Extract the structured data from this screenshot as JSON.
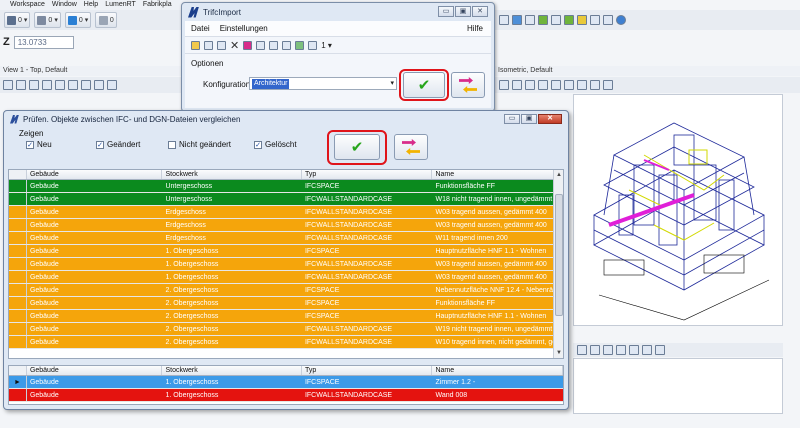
{
  "app": {
    "menu": [
      "Workspace",
      "Window",
      "Help",
      "LumenRT",
      "Fabrikpla"
    ],
    "z_label": "Z",
    "z_value": "13.0733",
    "view1_title": "View 1 - Top, Default",
    "iso_title": "Isometric, Default",
    "toolbar_counts": [
      "0",
      "0",
      "0",
      "0"
    ]
  },
  "trif": {
    "title": "TrifcImport",
    "menu": {
      "datei": "Datei",
      "einstellungen": "Einstellungen",
      "hilfe": "Hilfe"
    },
    "toolbar_page": "1",
    "optionen_label": "Optionen",
    "konfiguration_label": "Konfiguration",
    "konfiguration_value": "Architektur",
    "win_buttons": [
      "▭",
      "▣",
      "✕"
    ]
  },
  "compare": {
    "title": "Prüfen. Objekte zwischen IFC- und DGN-Dateien vergleichen",
    "zeigen_label": "Zeigen",
    "filters": [
      {
        "label": "Neu",
        "checked": true
      },
      {
        "label": "Geändert",
        "checked": true
      },
      {
        "label": "Nicht geändert",
        "checked": false
      },
      {
        "label": "Gelöscht",
        "checked": true
      }
    ],
    "columns": [
      "Gebäude",
      "Stockwerk",
      "Typ",
      "Name"
    ],
    "top_rows": [
      {
        "status": "green",
        "cells": [
          "Gebäude",
          "Untergeschoss",
          "IFCSPACE",
          "Funktionsfläche FF"
        ]
      },
      {
        "status": "green",
        "cells": [
          "Gebäude",
          "Untergeschoss",
          "IFCWALLSTANDARDCASE",
          "W18 nicht tragend innen, ungedämmt ..."
        ]
      },
      {
        "status": "orange",
        "cells": [
          "Gebäude",
          "Erdgeschoss",
          "IFCWALLSTANDARDCASE",
          "W03 tragend aussen, gedämmt 400"
        ]
      },
      {
        "status": "orange",
        "cells": [
          "Gebäude",
          "Erdgeschoss",
          "IFCWALLSTANDARDCASE",
          "W03 tragend aussen, gedämmt 400"
        ]
      },
      {
        "status": "orange",
        "cells": [
          "Gebäude",
          "Erdgeschoss",
          "IFCWALLSTANDARDCASE",
          "W11 tragend innen 200"
        ]
      },
      {
        "status": "orange",
        "cells": [
          "Gebäude",
          "1. Obergeschoss",
          "IFCSPACE",
          "Hauptnutzfläche HNF 1.1 - Wohnen"
        ]
      },
      {
        "status": "orange",
        "cells": [
          "Gebäude",
          "1. Obergeschoss",
          "IFCWALLSTANDARDCASE",
          "W03 tragend aussen, gedämmt 400"
        ]
      },
      {
        "status": "orange",
        "cells": [
          "Gebäude",
          "1. Obergeschoss",
          "IFCWALLSTANDARDCASE",
          "W03 tragend aussen, gedämmt 400"
        ]
      },
      {
        "status": "orange",
        "cells": [
          "Gebäude",
          "2. Obergeschoss",
          "IFCSPACE",
          "Nebennutzfläche NNF 12.4 - Nebenräu..."
        ]
      },
      {
        "status": "orange",
        "cells": [
          "Gebäude",
          "2. Obergeschoss",
          "IFCSPACE",
          "Funktionsfläche FF"
        ]
      },
      {
        "status": "orange",
        "cells": [
          "Gebäude",
          "2. Obergeschoss",
          "IFCSPACE",
          "Hauptnutzfläche HNF 1.1 - Wohnen"
        ]
      },
      {
        "status": "orange",
        "cells": [
          "Gebäude",
          "2. Obergeschoss",
          "IFCWALLSTANDARDCASE",
          "W19 nicht tragend innen, ungedämmt 1..."
        ]
      },
      {
        "status": "orange",
        "cells": [
          "Gebäude",
          "2. Obergeschoss",
          "IFCWALLSTANDARDCASE",
          "W10 tragend innen, nicht gedämmt, ge..."
        ]
      }
    ],
    "bottom_rows": [
      {
        "status": "blue",
        "selected": true,
        "cells": [
          "Gebäude",
          "1. Obergeschoss",
          "IFCSPACE",
          "Zimmer 1.2 -"
        ]
      },
      {
        "status": "red",
        "selected": false,
        "cells": [
          "Gebäude",
          "1. Obergeschoss",
          "IFCWALLSTANDARDCASE",
          "Wand 008"
        ]
      }
    ]
  },
  "colors": {
    "green": "#0b8a1e",
    "orange": "#f5a50b",
    "blue": "#3c9ae8",
    "red": "#e4130f",
    "highlight_ring": "#e0141a",
    "check": "#27a51b"
  }
}
